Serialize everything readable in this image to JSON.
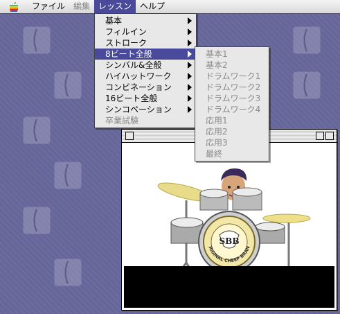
{
  "menubar": {
    "items": [
      {
        "label": "ファイル"
      },
      {
        "label": "編集"
      },
      {
        "label": "レッスン"
      },
      {
        "label": "ヘルプ"
      }
    ]
  },
  "lesson_menu": [
    {
      "label": "基本"
    },
    {
      "label": "フィルイン"
    },
    {
      "label": "ストローク"
    },
    {
      "label": "8ビート全般"
    },
    {
      "label": "シンバル&全般"
    },
    {
      "label": "ハイハットワーク"
    },
    {
      "label": "コンビネーション"
    },
    {
      "label": "16ビート全般"
    },
    {
      "label": "シンコペーション"
    },
    {
      "label": "卒業試験"
    }
  ],
  "submenu": [
    {
      "label": "基本1"
    },
    {
      "label": "基本2"
    },
    {
      "label": "ドラムワーク1"
    },
    {
      "label": "ドラムワーク2"
    },
    {
      "label": "ドラムワーク3"
    },
    {
      "label": "ドラムワーク4"
    },
    {
      "label": "応用1"
    },
    {
      "label": "応用2"
    },
    {
      "label": "応用3"
    },
    {
      "label": "最終"
    }
  ],
  "drum_badge": {
    "logo": "SBB",
    "text": "ORIGINAL CHEEP BRAND"
  },
  "colors": {
    "desktop": "#66669a",
    "highlight": "#4a4a9a"
  }
}
